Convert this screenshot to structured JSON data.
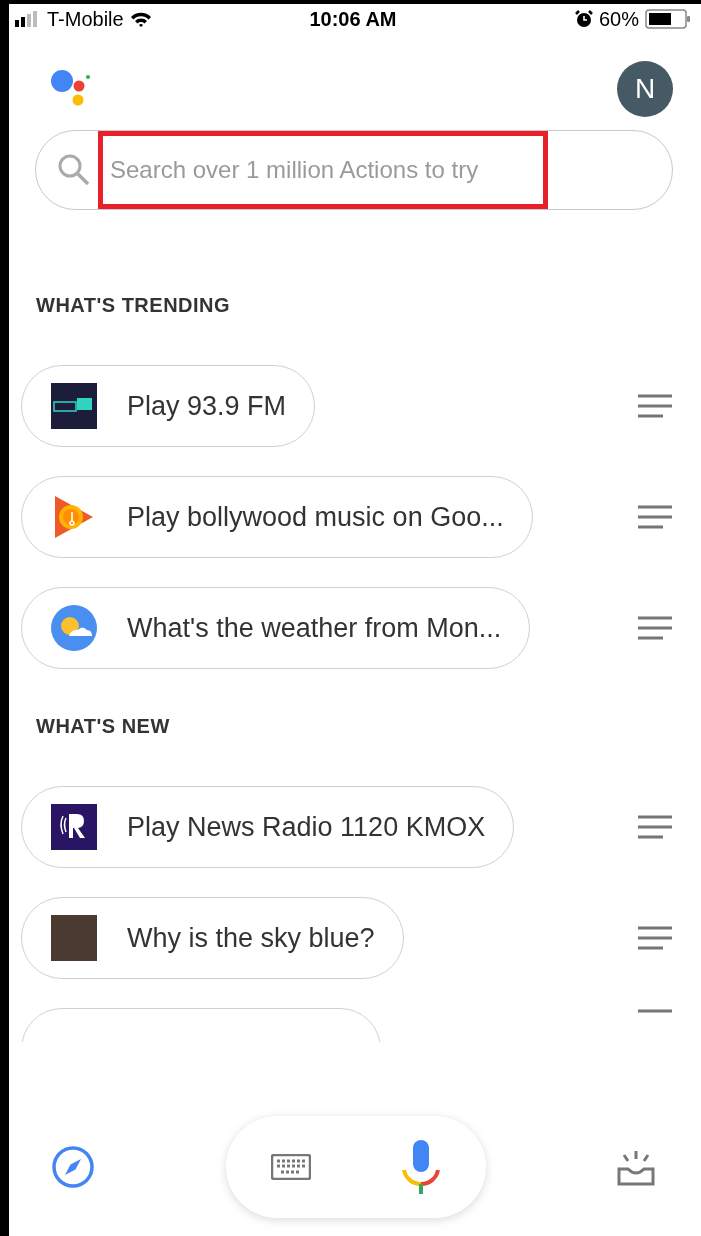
{
  "status_bar": {
    "carrier": "T-Mobile",
    "time": "10:06 AM",
    "battery": "60%"
  },
  "header": {
    "avatar_letter": "N"
  },
  "search": {
    "placeholder": "Search over 1 million Actions to try",
    "highlighted": true
  },
  "sections": [
    {
      "title": "WHAT'S TRENDING",
      "items": [
        {
          "kind": "tunein",
          "label": "Play 93.9 FM"
        },
        {
          "kind": "music",
          "label": "Play bollywood music on Goo..."
        },
        {
          "kind": "weather",
          "label": "What's the weather from Mon..."
        }
      ]
    },
    {
      "title": "WHAT'S NEW",
      "items": [
        {
          "kind": "radio",
          "label": "Play News Radio 1120 KMOX"
        },
        {
          "kind": "photo",
          "label": "Why is the sky blue?"
        }
      ]
    }
  ]
}
